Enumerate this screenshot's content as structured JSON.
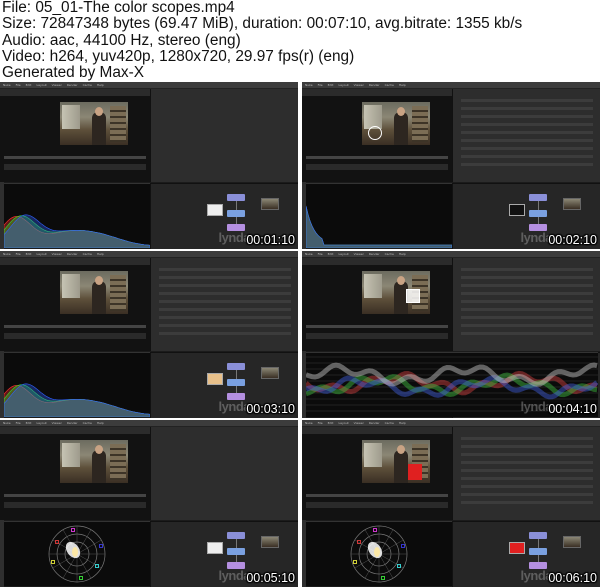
{
  "header": {
    "file": "File: 05_01-The color scopes.mp4",
    "size": "Size: 72847348 bytes (69.47 MiB), duration: 00:07:10, avg.bitrate: 1355 kb/s",
    "audio": "Audio: aac, 44100 Hz, stereo (eng)",
    "video": "Video: h264, yuv420p, 1280x720, 29.97 fps(r) (eng)",
    "generated": "Generated by Max-X"
  },
  "app_menu": [
    "Nuke",
    "File",
    "Edit",
    "Layout",
    "Viewer",
    "Render",
    "Cache",
    "Help"
  ],
  "thumbnails": [
    {
      "timestamp": "00:01:10",
      "scope": "histogram"
    },
    {
      "timestamp": "00:02:10",
      "scope": "histogram-dark"
    },
    {
      "timestamp": "00:03:10",
      "scope": "histogram"
    },
    {
      "timestamp": "00:04:10",
      "scope": "waveform"
    },
    {
      "timestamp": "00:05:10",
      "scope": "vectorscope"
    },
    {
      "timestamp": "00:06:10",
      "scope": "vectorscope"
    }
  ],
  "watermark": "lynda"
}
